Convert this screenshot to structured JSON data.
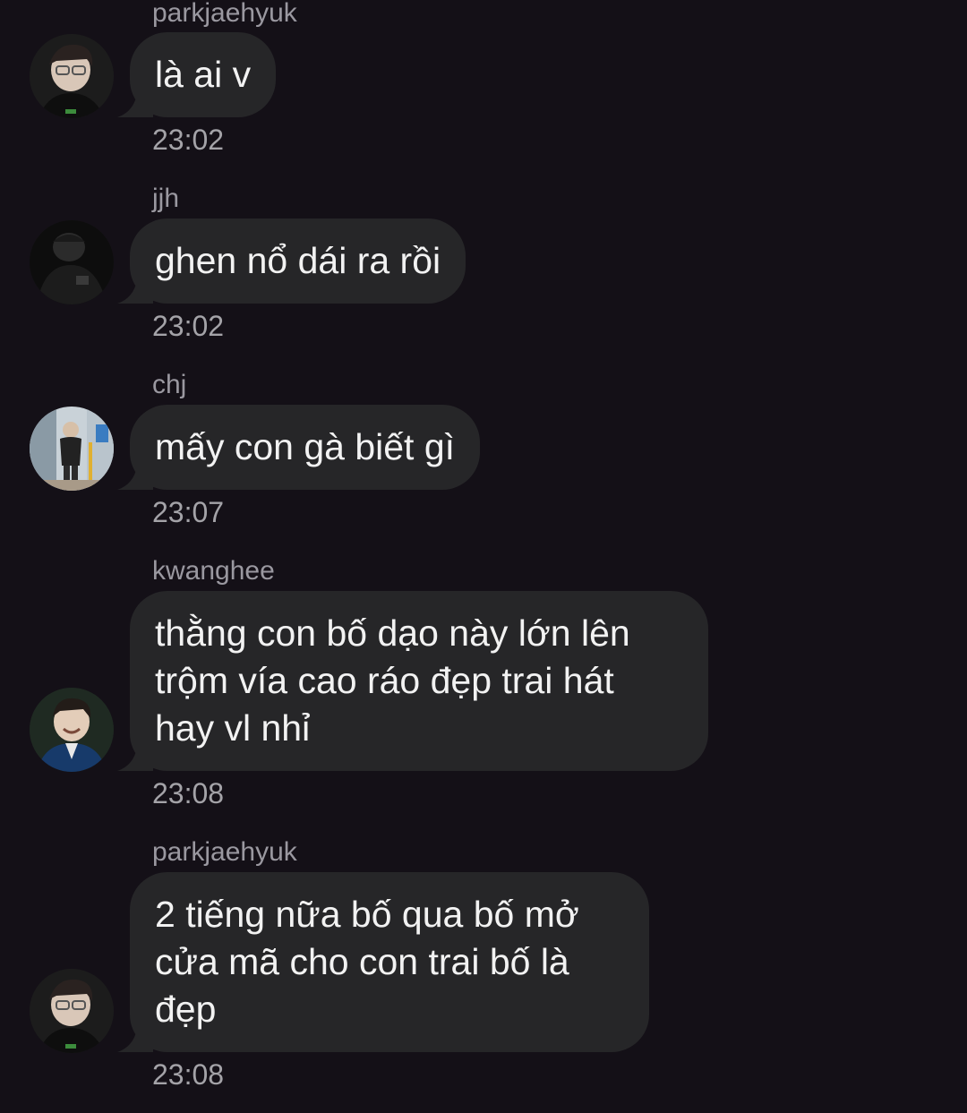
{
  "messages": [
    {
      "sender": "parkjaehyuk",
      "text": "là ai v",
      "time": "23:02",
      "avatar": "avatar-glasses-dark"
    },
    {
      "sender": "jjh",
      "text": "ghen nổ dái ra rồi",
      "time": "23:02",
      "avatar": "avatar-black-outfit"
    },
    {
      "sender": "chj",
      "text": "mấy con gà biết gì",
      "time": "23:07",
      "avatar": "avatar-street-photo"
    },
    {
      "sender": "kwanghee",
      "text": "thằng con bố dạo này lớn lên\ntrộm vía cao ráo đẹp trai hát\nhay vl nhỉ",
      "time": "23:08",
      "avatar": "avatar-smiling-jacket"
    },
    {
      "sender": "parkjaehyuk",
      "text": "2 tiếng nữa bố qua bố mở\ncửa mã cho con trai bố là\nđẹp",
      "time": "23:08",
      "avatar": "avatar-glasses-dark"
    }
  ]
}
